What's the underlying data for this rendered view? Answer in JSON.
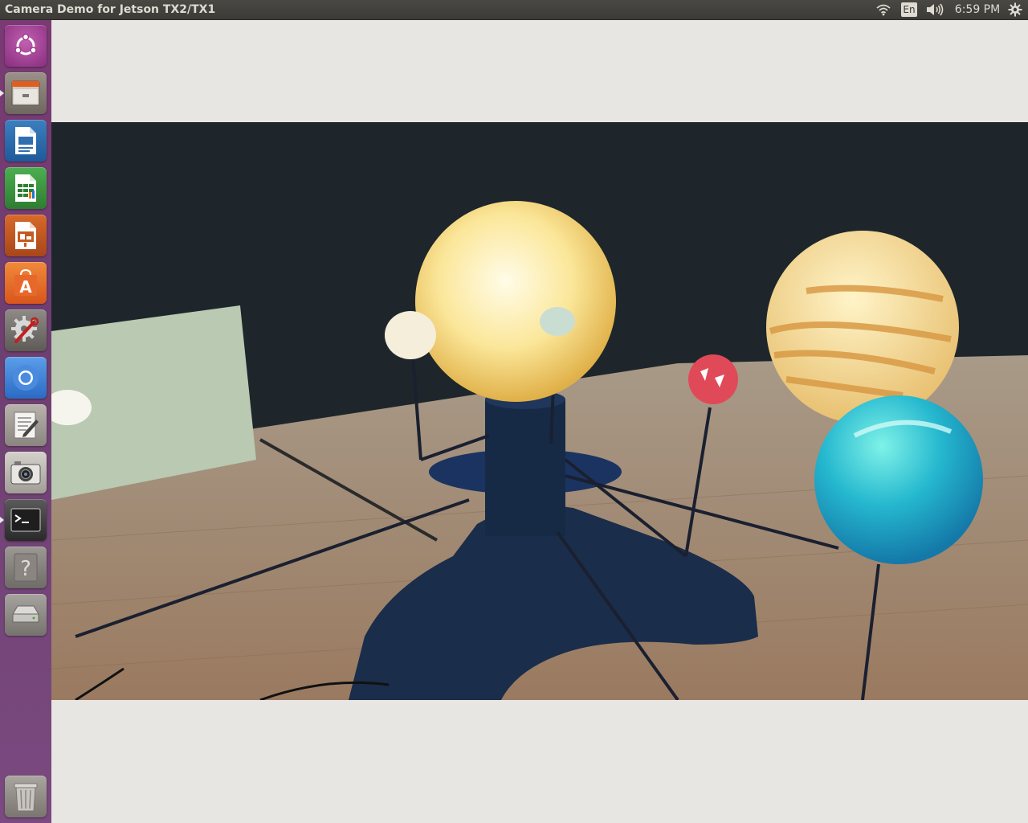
{
  "top_panel": {
    "window_title": "Camera Demo for Jetson TX2/TX1",
    "keyboard_layout": "En",
    "clock": "6:59 PM",
    "icons": {
      "network": "wifi-icon",
      "sound": "speaker-volume-icon",
      "system": "gear-icon"
    }
  },
  "launcher": {
    "items": [
      {
        "name": "ubuntu-dash",
        "icon": "ubuntu-logo-icon"
      },
      {
        "name": "files",
        "icon": "file-cabinet-icon"
      },
      {
        "name": "libreoffice-writer",
        "icon": "writer-document-icon"
      },
      {
        "name": "libreoffice-calc",
        "icon": "calc-spreadsheet-icon"
      },
      {
        "name": "libreoffice-impress",
        "icon": "impress-presentation-icon"
      },
      {
        "name": "ubuntu-software",
        "icon": "software-bag-icon"
      },
      {
        "name": "system-settings",
        "icon": "settings-gear-wrench-icon"
      },
      {
        "name": "chromium",
        "icon": "chromium-browser-icon"
      },
      {
        "name": "text-editor",
        "icon": "text-editor-icon"
      },
      {
        "name": "camera-app",
        "icon": "camera-icon"
      },
      {
        "name": "terminal",
        "icon": "terminal-icon"
      },
      {
        "name": "help",
        "icon": "help-question-icon"
      },
      {
        "name": "disk",
        "icon": "disk-drive-icon"
      },
      {
        "name": "trash",
        "icon": "trash-icon"
      }
    ]
  },
  "camera_view": {
    "description_icon": "camera-feed-solar-system-model"
  },
  "colors": {
    "panel": "#3c3b37",
    "launcher": "#76406f",
    "window_bg": "#e8e6e3"
  }
}
